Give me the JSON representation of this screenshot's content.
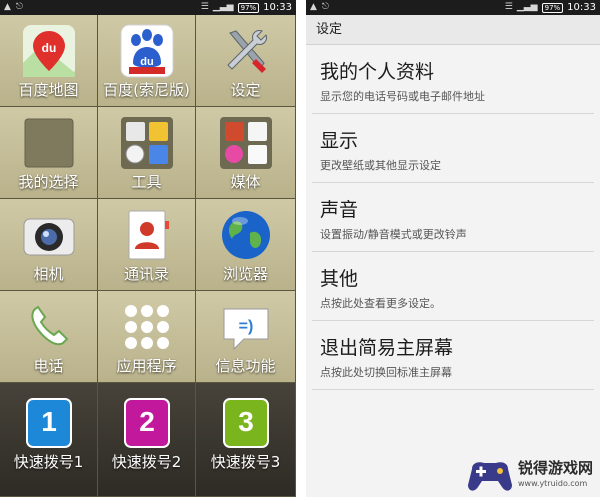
{
  "status_bar": {
    "time": "10:33",
    "battery": "97%",
    "left_icons": [
      "android-icon",
      "usb-icon"
    ]
  },
  "launcher": {
    "tiles": [
      {
        "label": "百度地图",
        "icon": "baidu-map-icon"
      },
      {
        "label": "百度(索尼版)",
        "icon": "baidu-paw-icon"
      },
      {
        "label": "设定",
        "icon": "tools-settings-icon"
      },
      {
        "label": "我的选择",
        "icon": "empty-slot-icon"
      },
      {
        "label": "工具",
        "icon": "tools-folder-icon"
      },
      {
        "label": "媒体",
        "icon": "media-folder-icon"
      },
      {
        "label": "相机",
        "icon": "camera-icon"
      },
      {
        "label": "通讯录",
        "icon": "contacts-icon"
      },
      {
        "label": "浏览器",
        "icon": "globe-icon"
      },
      {
        "label": "电话",
        "icon": "phone-icon"
      },
      {
        "label": "应用程序",
        "icon": "apps-grid-icon"
      },
      {
        "label": "信息功能",
        "icon": "messaging-icon"
      },
      {
        "label": "快速拨号1",
        "icon": "speed-dial-1-icon"
      },
      {
        "label": "快速拨号2",
        "icon": "speed-dial-2-icon"
      },
      {
        "label": "快速拨号3",
        "icon": "speed-dial-3-icon"
      }
    ]
  },
  "settings": {
    "title": "设定",
    "items": [
      {
        "title": "我的个人资料",
        "subtitle": "显示您的电话号码或电子邮件地址"
      },
      {
        "title": "显示",
        "subtitle": "更改壁纸或其他显示设定"
      },
      {
        "title": "声音",
        "subtitle": "设置振动/静音模式或更改铃声"
      },
      {
        "title": "其他",
        "subtitle": "点按此处查看更多设定。"
      },
      {
        "title": "退出简易主屏幕",
        "subtitle": "点按此处切换回标准主屏幕"
      }
    ]
  },
  "watermark": {
    "name": "锐得游戏网",
    "url": "www.ytruido.com"
  },
  "colors": {
    "tile_light": "#cfc9a6",
    "tile_dark": "#2e2b25",
    "speed_dial_1": "#1e88d8",
    "speed_dial_2": "#c2189b",
    "speed_dial_3": "#7ab51d"
  }
}
